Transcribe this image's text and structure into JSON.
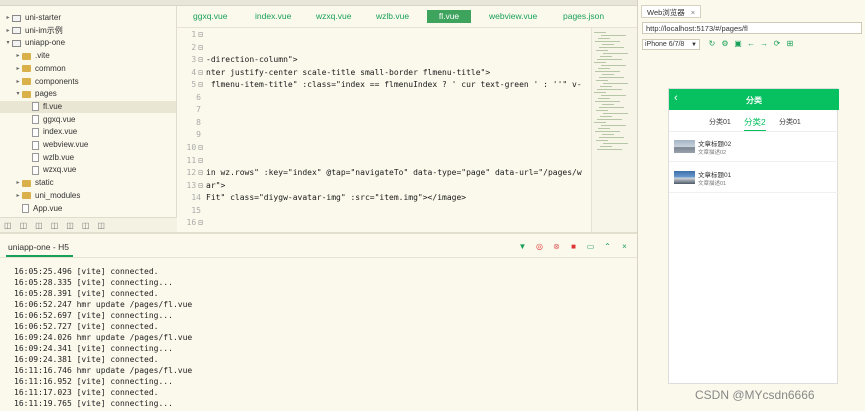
{
  "sidebar": {
    "items": [
      {
        "label": "uni-starter",
        "type": "project",
        "arrow": ">"
      },
      {
        "label": "uni-im示例",
        "type": "project",
        "arrow": ">"
      },
      {
        "label": "uniapp-one",
        "type": "project",
        "arrow": "v"
      },
      {
        "label": ".vite",
        "type": "folder",
        "arrow": ">"
      },
      {
        "label": "common",
        "type": "folder",
        "arrow": ">"
      },
      {
        "label": "components",
        "type": "folder",
        "arrow": ">"
      },
      {
        "label": "pages",
        "type": "folder",
        "arrow": "v"
      },
      {
        "label": "fl.vue",
        "type": "file",
        "selected": true
      },
      {
        "label": "ggxq.vue",
        "type": "file"
      },
      {
        "label": "index.vue",
        "type": "file"
      },
      {
        "label": "webview.vue",
        "type": "file"
      },
      {
        "label": "wzlb.vue",
        "type": "file"
      },
      {
        "label": "wzxq.vue",
        "type": "file"
      },
      {
        "label": "static",
        "type": "folder",
        "arrow": ">"
      },
      {
        "label": "uni_modules",
        "type": "folder",
        "arrow": ">"
      },
      {
        "label": "App.vue",
        "type": "file"
      }
    ]
  },
  "tabs": [
    {
      "label": "ggxq.vue"
    },
    {
      "label": "index.vue"
    },
    {
      "label": "wzxq.vue"
    },
    {
      "label": "wzlb.vue"
    },
    {
      "label": "fl.vue",
      "active": true
    },
    {
      "label": "webview.vue"
    },
    {
      "label": "pages.json"
    }
  ],
  "editor": {
    "lines": [
      {
        "n": "1",
        "fold": "⊟",
        "text": ""
      },
      {
        "n": "2",
        "fold": "⊟",
        "text": ""
      },
      {
        "n": "3",
        "fold": "⊟",
        "text": "-direction-column\">"
      },
      {
        "n": "4",
        "fold": "⊟",
        "text": "nter justify-center scale-title small-border flmenu-title\">"
      },
      {
        "n": "5",
        "fold": "⊟",
        "text": " flmenu-item-title\" :class=\"index == flmenuIndex ? ' cur text-green ' : ''\" v-"
      },
      {
        "n": "6",
        "fold": "",
        "text": ""
      },
      {
        "n": "7",
        "fold": "",
        "text": ""
      },
      {
        "n": "8",
        "fold": "",
        "text": ""
      },
      {
        "n": "9",
        "fold": "",
        "text": ""
      },
      {
        "n": "10",
        "fold": "⊟",
        "text": ""
      },
      {
        "n": "11",
        "fold": "⊟",
        "text": ""
      },
      {
        "n": "12",
        "fold": "⊟",
        "text": "in wz.rows\" :key=\"index\" @tap=\"navigateTo\" data-type=\"page\" data-url=\"/pages/w"
      },
      {
        "n": "13",
        "fold": "⊟",
        "text": "ar\">"
      },
      {
        "n": "14",
        "fold": "",
        "text": "Fit\" class=\"diygw-avatar-img\" :src=\"item.img\"></image>"
      },
      {
        "n": "15",
        "fold": "",
        "text": ""
      },
      {
        "n": "16",
        "fold": "⊟",
        "text": ""
      },
      {
        "n": "17",
        "fold": "⊟",
        "text": ">"
      }
    ]
  },
  "console": {
    "title": "uniapp-one - H5",
    "logs": [
      "16:05:25.496 [vite] connected.",
      "16:05:28.335 [vite] connecting...",
      "16:05:28.391 [vite] connected.",
      "16:06:52.247 hmr update /pages/fl.vue",
      "16:06:52.697 [vite] connecting...",
      "16:06:52.727 [vite] connected.",
      "16:09:24.026 hmr update /pages/fl.vue",
      "16:09:24.341 [vite] connecting...",
      "16:09:24.381 [vite] connected.",
      "16:11:16.746 hmr update /pages/fl.vue",
      "16:11:16.952 [vite] connecting...",
      "16:11:17.023 [vite] connected.",
      "16:11:19.765 [vite] connecting...",
      "16:11:19.842 [vite] connected."
    ]
  },
  "browser": {
    "tab_label": "Web浏览器",
    "url": "http://localhost:5173/#/pages/fl",
    "device": "iPhone 6/7/8"
  },
  "phone": {
    "nav_title": "分类",
    "categories": [
      "分类01",
      "分类2",
      "分类01"
    ],
    "active_category": 1,
    "items": [
      {
        "title": "文章标题02",
        "desc": "文章描述02"
      },
      {
        "title": "文章标题01",
        "desc": "文章描述01"
      }
    ]
  },
  "watermark": "CSDN @MYcsdn6666",
  "colors": {
    "accent": "#18a058",
    "phone_nav": "#07c160",
    "bg": "#fbf9ec"
  }
}
